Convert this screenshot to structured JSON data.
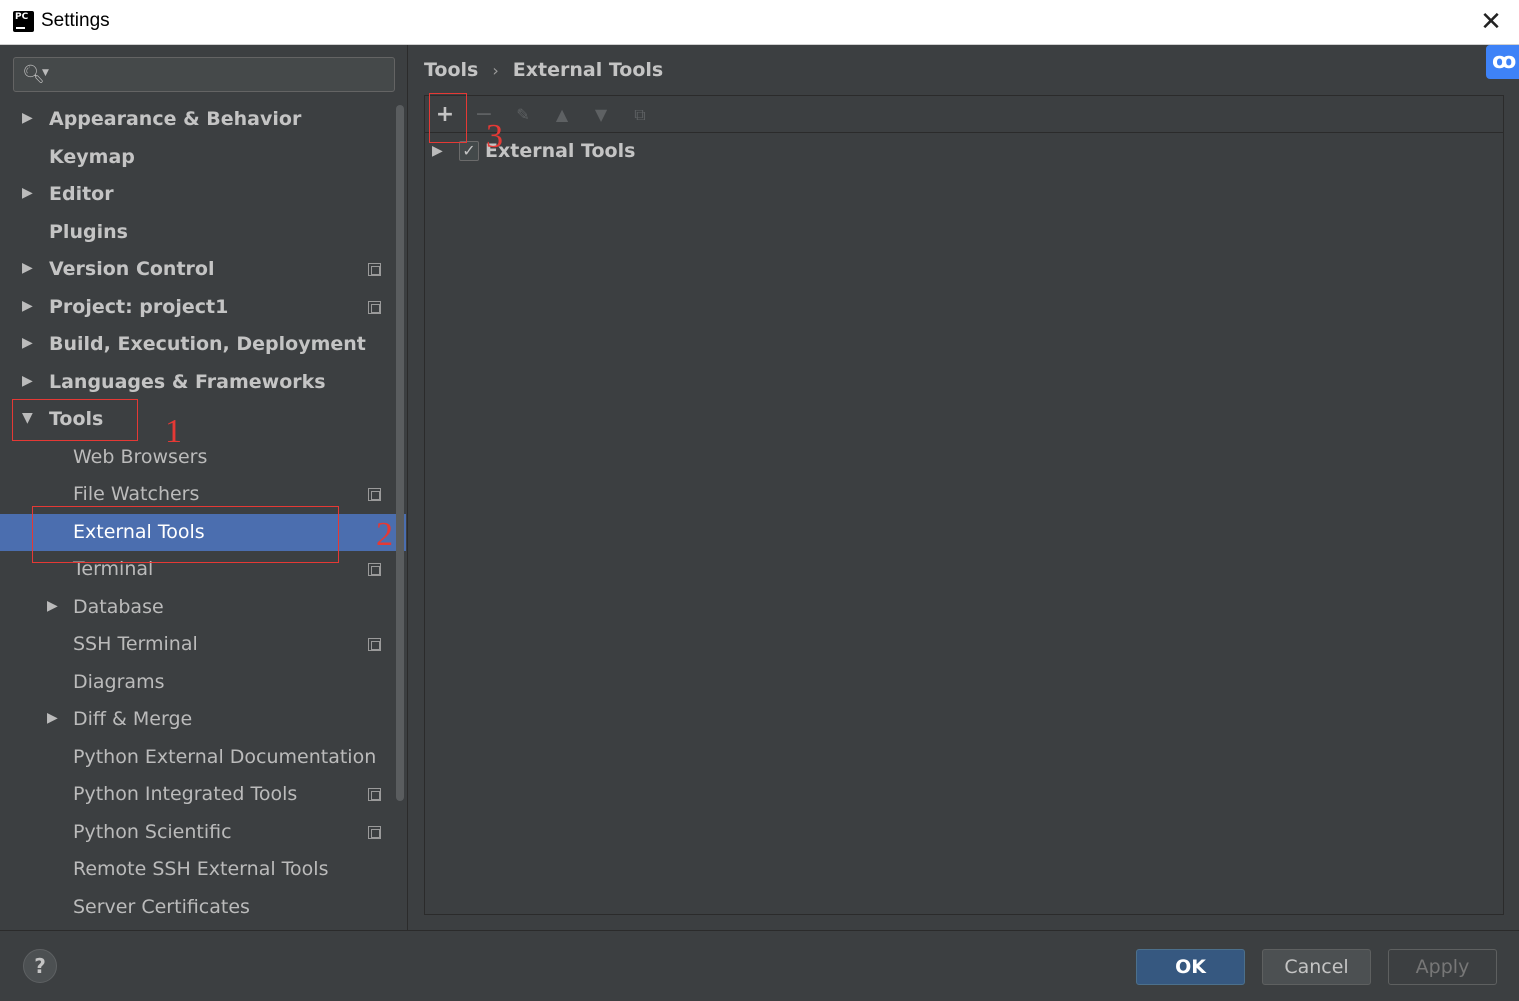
{
  "window": {
    "title": "Settings",
    "close_glyph": "✕",
    "app_icon": "pycharm-icon",
    "app_icon_text": "PC"
  },
  "search": {
    "placeholder": "",
    "icon": "search-icon"
  },
  "tree": {
    "items": [
      {
        "label": "Appearance & Behavior",
        "expandable": true,
        "expanded": false,
        "bold": true,
        "level": 0,
        "project_icon": false
      },
      {
        "label": "Keymap",
        "expandable": false,
        "bold": true,
        "level": 0,
        "project_icon": false
      },
      {
        "label": "Editor",
        "expandable": true,
        "expanded": false,
        "bold": true,
        "level": 0,
        "project_icon": false
      },
      {
        "label": "Plugins",
        "expandable": false,
        "bold": true,
        "level": 0,
        "project_icon": false
      },
      {
        "label": "Version Control",
        "expandable": true,
        "expanded": false,
        "bold": true,
        "level": 0,
        "project_icon": true
      },
      {
        "label": "Project: project1",
        "expandable": true,
        "expanded": false,
        "bold": true,
        "level": 0,
        "project_icon": true
      },
      {
        "label": "Build, Execution, Deployment",
        "expandable": true,
        "expanded": false,
        "bold": true,
        "level": 0,
        "project_icon": false
      },
      {
        "label": "Languages & Frameworks",
        "expandable": true,
        "expanded": false,
        "bold": true,
        "level": 0,
        "project_icon": false
      },
      {
        "label": "Tools",
        "expandable": true,
        "expanded": true,
        "bold": true,
        "level": 0,
        "project_icon": false
      },
      {
        "label": "Web Browsers",
        "expandable": false,
        "bold": false,
        "level": 1,
        "project_icon": false
      },
      {
        "label": "File Watchers",
        "expandable": false,
        "bold": false,
        "level": 1,
        "project_icon": true
      },
      {
        "label": "External Tools",
        "expandable": false,
        "bold": false,
        "level": 1,
        "project_icon": false,
        "selected": true
      },
      {
        "label": "Terminal",
        "expandable": false,
        "bold": false,
        "level": 1,
        "project_icon": true
      },
      {
        "label": "Database",
        "expandable": true,
        "expanded": false,
        "bold": false,
        "level": 1,
        "project_icon": false
      },
      {
        "label": "SSH Terminal",
        "expandable": false,
        "bold": false,
        "level": 1,
        "project_icon": true
      },
      {
        "label": "Diagrams",
        "expandable": false,
        "bold": false,
        "level": 1,
        "project_icon": false
      },
      {
        "label": "Diff & Merge",
        "expandable": true,
        "expanded": false,
        "bold": false,
        "level": 1,
        "project_icon": false
      },
      {
        "label": "Python External Documentation",
        "expandable": false,
        "bold": false,
        "level": 1,
        "project_icon": false
      },
      {
        "label": "Python Integrated Tools",
        "expandable": false,
        "bold": false,
        "level": 1,
        "project_icon": true
      },
      {
        "label": "Python Scientific",
        "expandable": false,
        "bold": false,
        "level": 1,
        "project_icon": true
      },
      {
        "label": "Remote SSH External Tools",
        "expandable": false,
        "bold": false,
        "level": 1,
        "project_icon": false
      },
      {
        "label": "Server Certificates",
        "expandable": false,
        "bold": false,
        "level": 1,
        "project_icon": false
      }
    ]
  },
  "breadcrumb": {
    "parent": "Tools",
    "separator": "›",
    "current": "External Tools"
  },
  "toolbar": {
    "add": "+",
    "remove": "−",
    "edit": "✎",
    "up": "▲",
    "down": "▼",
    "copy": "⧉"
  },
  "tool_groups": [
    {
      "label": "External Tools",
      "checked": true,
      "check_glyph": "✓"
    }
  ],
  "annotations": {
    "one": "1",
    "two": "2",
    "three": "3"
  },
  "buttons": {
    "help": "?",
    "ok": "OK",
    "cancel": "Cancel",
    "apply": "Apply"
  },
  "colors": {
    "background": "#3c3f41",
    "selection": "#4b6eaf",
    "annotation": "#e53935",
    "ok_button": "#365880"
  },
  "baidu_widget": {
    "glyph": "ꝏ"
  }
}
